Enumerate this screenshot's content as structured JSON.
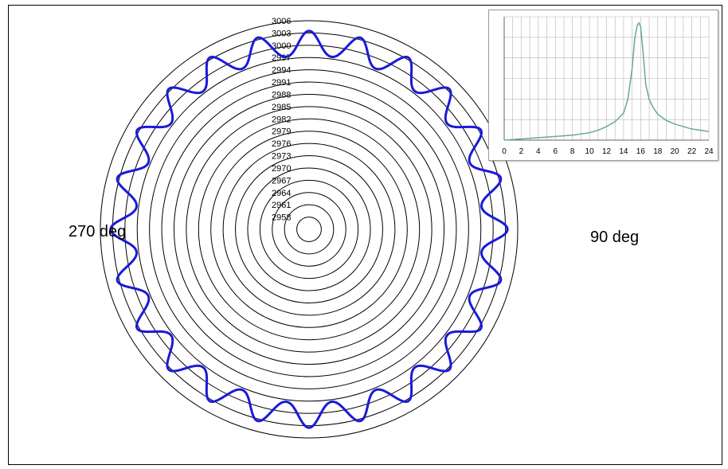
{
  "colors": {
    "series": "#1a1ad8",
    "rings": "#000000",
    "inset_line": "#6aa893",
    "inset_grid": "#b5b5b5"
  },
  "labels": {
    "left": "270 deg",
    "right": "90 deg"
  },
  "chart_data": [
    {
      "type": "polar-line",
      "radial_ticks": [
        "3006",
        "3003",
        "3000",
        "2997",
        "2994",
        "2991",
        "2988",
        "2985",
        "2982",
        "2979",
        "2976",
        "2973",
        "2970",
        "2967",
        "2964",
        "2961",
        "2958"
      ],
      "rlim": [
        2955,
        3006
      ],
      "angle_labels": [
        "270 deg",
        "90 deg"
      ],
      "series": [
        {
          "lobes": 24,
          "r_min": 2997,
          "r_max": 3003.5
        }
      ]
    },
    {
      "type": "line",
      "x_ticks": [
        "0",
        "2",
        "4",
        "6",
        "8",
        "10",
        "12",
        "14",
        "16",
        "18",
        "20",
        "22",
        "24"
      ],
      "xlim": [
        0,
        24
      ],
      "ylim": [
        0,
        1
      ],
      "grid": true,
      "series": [
        {
          "x": [
            0,
            2,
            4,
            6,
            8,
            10,
            11,
            12,
            13,
            14,
            14.5,
            15,
            15.3,
            15.6,
            15.8,
            16,
            16.3,
            16.6,
            17,
            17.5,
            18,
            19,
            20,
            22,
            24
          ],
          "y": [
            0.0,
            0.01,
            0.02,
            0.03,
            0.04,
            0.06,
            0.08,
            0.11,
            0.15,
            0.22,
            0.33,
            0.58,
            0.82,
            0.93,
            0.95,
            0.92,
            0.7,
            0.45,
            0.33,
            0.26,
            0.21,
            0.16,
            0.13,
            0.09,
            0.07
          ]
        }
      ]
    }
  ]
}
